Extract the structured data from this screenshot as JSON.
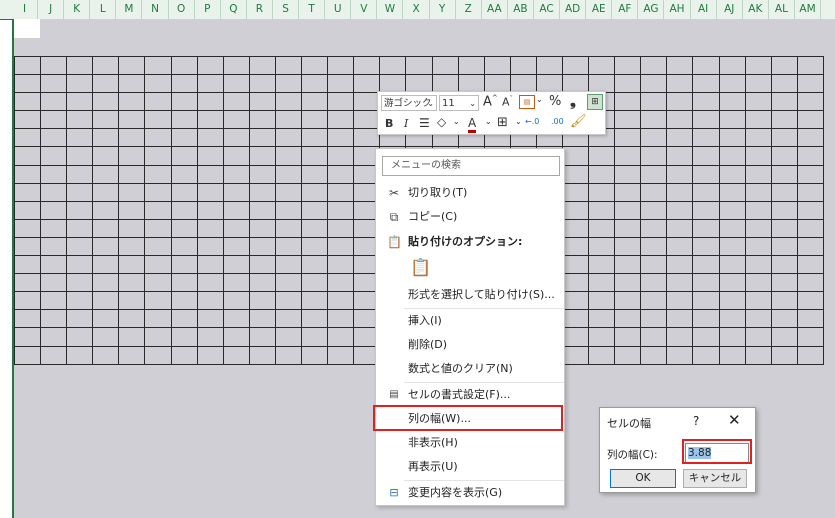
{
  "sheet": {
    "columns": [
      "I",
      "J",
      "K",
      "L",
      "M",
      "N",
      "O",
      "P",
      "Q",
      "R",
      "S",
      "T",
      "U",
      "V",
      "W",
      "X",
      "Y",
      "Z",
      "AA",
      "AB",
      "AC",
      "AD",
      "AE",
      "AF",
      "AG",
      "AH",
      "AI",
      "AJ",
      "AK",
      "AL",
      "AM"
    ]
  },
  "mini_toolbar": {
    "font_name": "游ゴシック",
    "font_size": "11",
    "grow_font": "A",
    "shrink_font": "A",
    "percent": "%",
    "comma": "❟",
    "bold": "B",
    "italic": "I",
    "align": "☰",
    "font_color_letter": "A",
    "font_color": "#c00000",
    "decimal_increase": "←.0",
    "decimal_decrease": ".00"
  },
  "context_menu": {
    "search_placeholder": "メニューの検索",
    "items": {
      "cut": "切り取り(T)",
      "copy": "コピー(C)",
      "paste_options": "貼り付けのオプション:",
      "paste_special": "形式を選択して貼り付け(S)...",
      "insert": "挿入(I)",
      "delete": "削除(D)",
      "clear": "数式と値のクリア(N)",
      "format_cells": "セルの書式設定(F)...",
      "column_width": "列の幅(W)...",
      "hide": "非表示(H)",
      "unhide": "再表示(U)",
      "show_changes": "変更内容を表示(G)"
    }
  },
  "dialog": {
    "title": "セルの幅",
    "help": "?",
    "close": "✕",
    "label": "列の幅(C):",
    "value": "3.88",
    "ok": "OK",
    "cancel": "キャンセル"
  },
  "colors": {
    "header_green": "#1f7a3f",
    "selection_gray": "#d0cfd5",
    "highlight_red": "#e41f1f"
  }
}
